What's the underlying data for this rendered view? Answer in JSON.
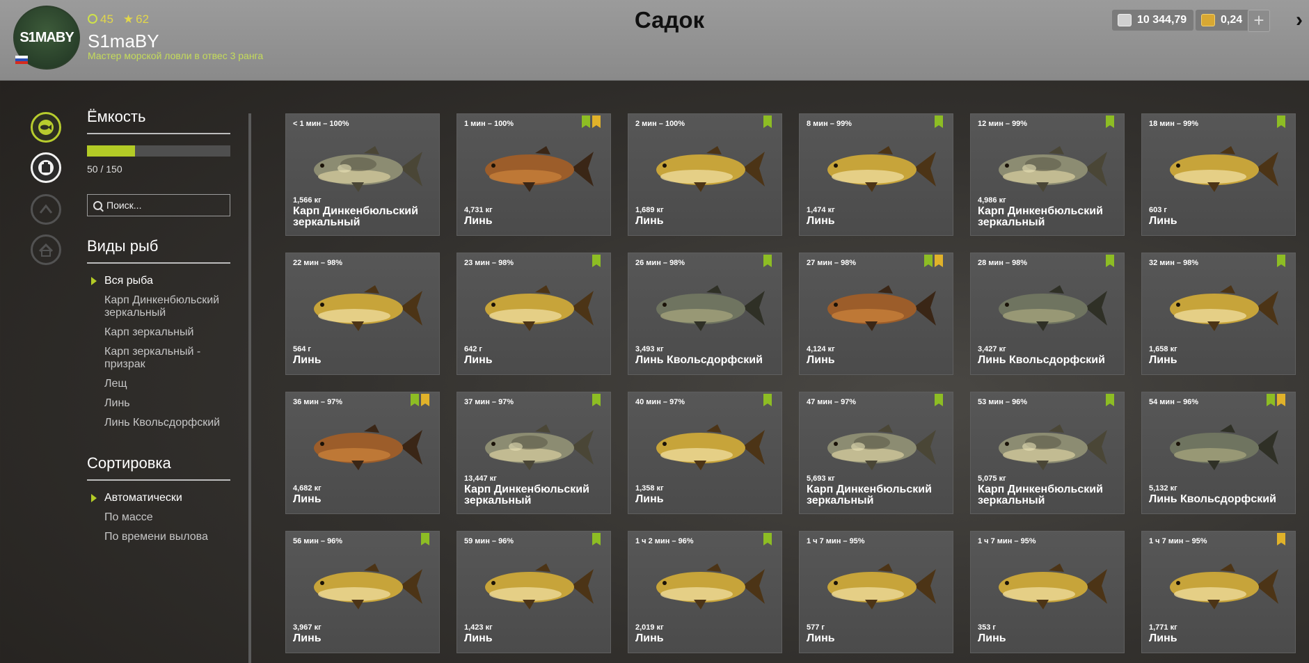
{
  "header": {
    "title": "Садок",
    "level": "45",
    "stars": "62",
    "player_name": "S1maBY",
    "rank": "Мастер морской ловли в отвес 3 ранга",
    "avatar_text": "S1MABY",
    "silver": "10 344,79",
    "gold": "0,24"
  },
  "sidebar": {
    "capacity_title": "Ёмкость",
    "capacity_label": "50 / 150",
    "capacity_fraction": 0.333,
    "search_placeholder": "Поиск...",
    "species_title": "Виды рыб",
    "species": [
      "Вся рыба",
      "Карп Динкенбюльский зеркальный",
      "Карп зеркальный",
      "Карп зеркальный - призрак",
      "Лещ",
      "Линь",
      "Линь Квольсдорфский"
    ],
    "sort_title": "Сортировка",
    "sort": [
      "Автоматически",
      "По массе",
      "По времени вылова"
    ]
  },
  "colors": {
    "accent": "#b3cb26",
    "tench": "#c7a43a",
    "tench_dark": "#9c5d2a",
    "carp": "#8c8c72",
    "grey_tench": "#6f7460",
    "badge_green": "#8dbd24",
    "badge_star": "#e0b22a"
  },
  "fish": [
    {
      "time": "< 1 мин – 100%",
      "weight": "1,566 кг",
      "name": "Карп Динкенбюльский зеркальный",
      "kind": "carp",
      "badges": []
    },
    {
      "time": "1 мин – 100%",
      "weight": "4,731 кг",
      "name": "Линь",
      "kind": "tench_dark",
      "badges": [
        "green",
        "star"
      ]
    },
    {
      "time": "2 мин – 100%",
      "weight": "1,689 кг",
      "name": "Линь",
      "kind": "tench",
      "badges": [
        "green"
      ]
    },
    {
      "time": "8 мин – 99%",
      "weight": "1,474 кг",
      "name": "Линь",
      "kind": "tench",
      "badges": [
        "green"
      ]
    },
    {
      "time": "12 мин – 99%",
      "weight": "4,986 кг",
      "name": "Карп Динкенбюльский зеркальный",
      "kind": "carp",
      "badges": [
        "green"
      ]
    },
    {
      "time": "18 мин – 99%",
      "weight": "603 г",
      "name": "Линь",
      "kind": "tench",
      "badges": [
        "green"
      ]
    },
    {
      "time": "22 мин – 98%",
      "weight": "564 г",
      "name": "Линь",
      "kind": "tench",
      "badges": []
    },
    {
      "time": "23 мин – 98%",
      "weight": "642 г",
      "name": "Линь",
      "kind": "tench",
      "badges": [
        "green"
      ]
    },
    {
      "time": "26 мин – 98%",
      "weight": "3,493 кг",
      "name": "Линь Квольсдорфский",
      "kind": "grey_tench",
      "badges": [
        "green"
      ]
    },
    {
      "time": "27 мин – 98%",
      "weight": "4,124 кг",
      "name": "Линь",
      "kind": "tench_dark",
      "badges": [
        "green",
        "star"
      ]
    },
    {
      "time": "28 мин – 98%",
      "weight": "3,427 кг",
      "name": "Линь Квольсдорфский",
      "kind": "grey_tench",
      "badges": [
        "green"
      ]
    },
    {
      "time": "32 мин – 98%",
      "weight": "1,658 кг",
      "name": "Линь",
      "kind": "tench",
      "badges": [
        "green"
      ]
    },
    {
      "time": "36 мин – 97%",
      "weight": "4,682 кг",
      "name": "Линь",
      "kind": "tench_dark",
      "badges": [
        "green",
        "star"
      ]
    },
    {
      "time": "37 мин – 97%",
      "weight": "13,447 кг",
      "name": "Карп Динкенбюльский зеркальный",
      "kind": "carp",
      "badges": [
        "green"
      ]
    },
    {
      "time": "40 мин – 97%",
      "weight": "1,358 кг",
      "name": "Линь",
      "kind": "tench",
      "badges": [
        "green"
      ]
    },
    {
      "time": "47 мин – 97%",
      "weight": "5,693 кг",
      "name": "Карп Динкенбюльский зеркальный",
      "kind": "carp",
      "badges": [
        "green"
      ]
    },
    {
      "time": "53 мин – 96%",
      "weight": "5,075 кг",
      "name": "Карп Динкенбюльский зеркальный",
      "kind": "carp",
      "badges": [
        "green"
      ]
    },
    {
      "time": "54 мин – 96%",
      "weight": "5,132 кг",
      "name": "Линь Квольсдорфский",
      "kind": "grey_tench",
      "badges": [
        "green",
        "star"
      ]
    },
    {
      "time": "56 мин – 96%",
      "weight": "3,967 кг",
      "name": "Линь",
      "kind": "tench",
      "badges": [
        "green"
      ]
    },
    {
      "time": "59 мин – 96%",
      "weight": "1,423 кг",
      "name": "Линь",
      "kind": "tench",
      "badges": [
        "green"
      ]
    },
    {
      "time": "1 ч 2 мин – 96%",
      "weight": "2,019 кг",
      "name": "Линь",
      "kind": "tench",
      "badges": [
        "green"
      ]
    },
    {
      "time": "1 ч 7 мин – 95%",
      "weight": "577 г",
      "name": "Линь",
      "kind": "tench",
      "badges": []
    },
    {
      "time": "1 ч 7 мин – 95%",
      "weight": "353 г",
      "name": "Линь",
      "kind": "tench",
      "badges": []
    },
    {
      "time": "1 ч 7 мин – 95%",
      "weight": "1,771 кг",
      "name": "Линь",
      "kind": "tench",
      "badges": [
        "star"
      ]
    }
  ]
}
